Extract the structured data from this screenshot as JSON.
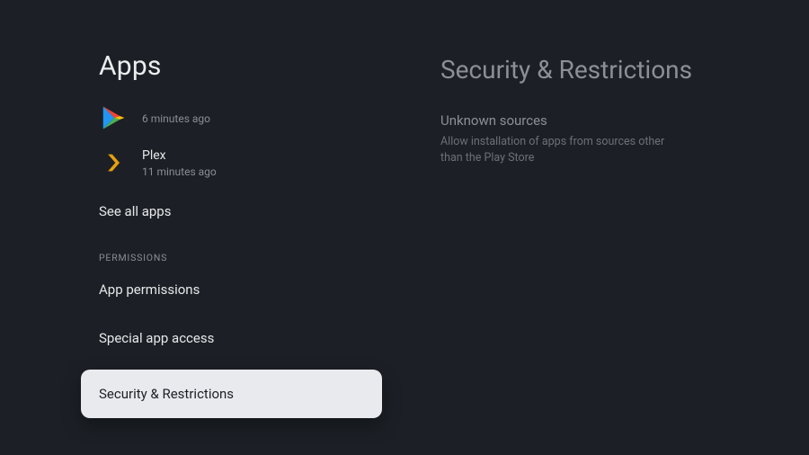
{
  "left": {
    "title": "Apps",
    "recent": [
      {
        "name": "",
        "time": "6 minutes ago",
        "icon": "play"
      },
      {
        "name": "Plex",
        "time": "11 minutes ago",
        "icon": "plex"
      }
    ],
    "see_all": "See all apps",
    "perm_label": "PERMISSIONS",
    "app_permissions": "App permissions",
    "special_access": "Special app access",
    "security": "Security & Restrictions"
  },
  "right": {
    "title": "Security & Restrictions",
    "unknown_heading": "Unknown sources",
    "unknown_sub": "Allow installation of apps from sources other than the Play Store"
  }
}
